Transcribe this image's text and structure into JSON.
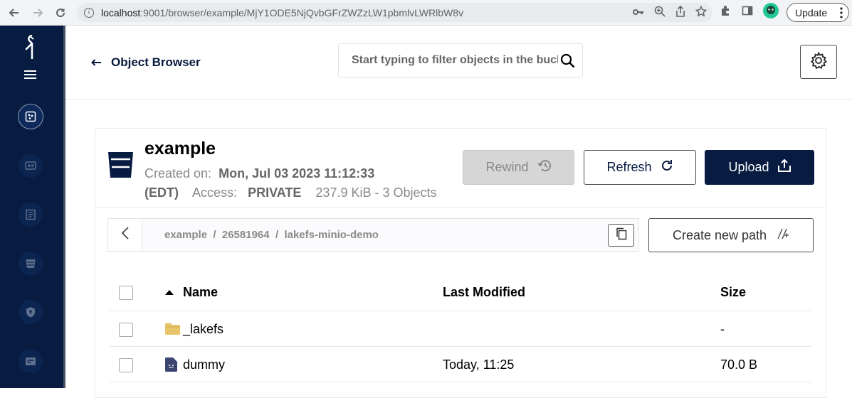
{
  "browser": {
    "url_host": "localhost",
    "url_path": ":9001/browser/example/MjY1ODE5NjQvbGFrZWZzLW1pbmlvLWRlbW8v",
    "update_label": "Update"
  },
  "header": {
    "back_label": "Object Browser",
    "search_placeholder": "Start typing to filter objects in the bucket"
  },
  "bucket": {
    "name": "example",
    "created_label": "Created on:",
    "created_value": "Mon, Jul 03 2023 11:12:33",
    "timezone": "(EDT)",
    "access_label": "Access:",
    "access_value": "PRIVATE",
    "summary": "237.9 KiB - 3 Objects"
  },
  "actions": {
    "rewind_label": "Rewind",
    "refresh_label": "Refresh",
    "upload_label": "Upload",
    "create_path_label": "Create new path"
  },
  "path": {
    "segments": [
      "example",
      "26581964",
      "lakefs-minio-demo"
    ],
    "display": "example  /  26581964  /  lakefs-minio-demo"
  },
  "table": {
    "columns": [
      "Name",
      "Last Modified",
      "Size"
    ],
    "rows": [
      {
        "name": "_lakefs",
        "type": "folder",
        "modified": "",
        "size": "-"
      },
      {
        "name": "dummy",
        "type": "file",
        "modified": "Today, 11:25",
        "size": "70.0 B"
      }
    ]
  },
  "colors": {
    "sidebar": "#081c42",
    "primary": "#081c42",
    "folder": "#e8c56b",
    "disabled": "#d6d6d6"
  },
  "icons": {
    "sidebar": [
      "minio-logo-icon",
      "menu-icon",
      "object-browser-icon",
      "access-keys-icon",
      "documentation-icon",
      "buckets-icon",
      "policies-icon",
      "identity-icon"
    ]
  }
}
